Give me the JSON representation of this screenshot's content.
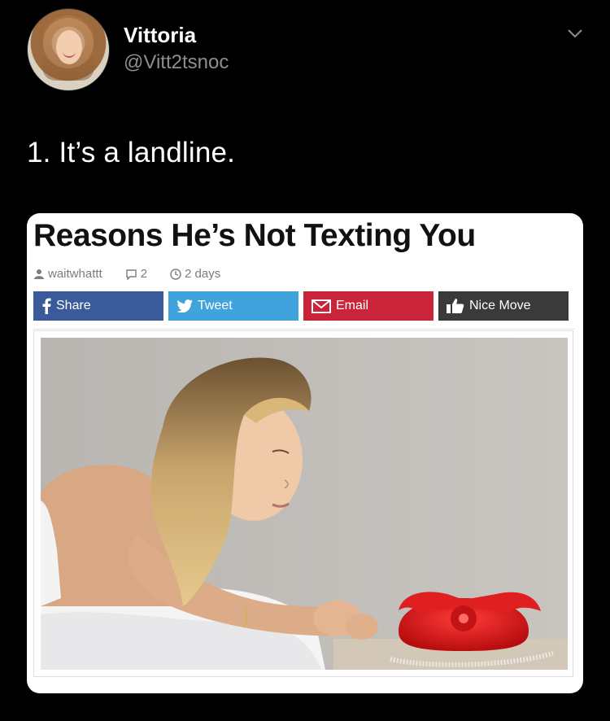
{
  "tweet": {
    "author_name": "Vittoria",
    "author_handle": "@Vitt2tsnoc",
    "text": "1. It’s a landline."
  },
  "article": {
    "title": "Reasons He’s Not Texting You",
    "author": "waitwhattt",
    "comments": "2",
    "age": "2 days",
    "buttons": [
      {
        "label": "Share",
        "icon": "facebook-icon",
        "color": "#3a5a99"
      },
      {
        "label": "Tweet",
        "icon": "twitter-bird-icon",
        "color": "#40a3dd"
      },
      {
        "label": "Email",
        "icon": "envelope-icon",
        "color": "#c9243a"
      },
      {
        "label": "Nice Move",
        "icon": "thumbs-up-icon",
        "color": "#3a3a3a"
      }
    ]
  },
  "colors": {
    "background": "#000000",
    "handle_gray": "#8b8f94",
    "card_bg": "#ffffff"
  }
}
